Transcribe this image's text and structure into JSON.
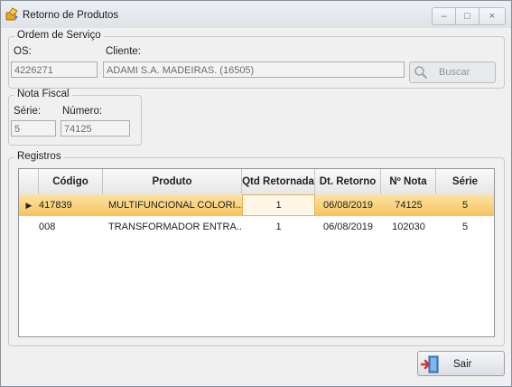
{
  "window": {
    "title": "Retorno de Produtos",
    "minimize_glyph": "–",
    "maximize_glyph": "□",
    "close_glyph": "×"
  },
  "ordem_servico": {
    "legend": "Ordem de Serviço",
    "os_label": "OS:",
    "os_value": "4226271",
    "cliente_label": "Cliente:",
    "cliente_value": "ADAMI S.A. MADEIRAS. (16505)",
    "buscar_label": "Buscar"
  },
  "nota_fiscal": {
    "legend": "Nota Fiscal",
    "serie_label": "Série:",
    "serie_value": "5",
    "numero_label": "Número:",
    "numero_value": "74125"
  },
  "registros": {
    "legend": "Registros",
    "columns": [
      "Código",
      "Produto",
      "Qtd Retornada",
      "Dt. Retorno",
      "Nº Nota",
      "Série"
    ],
    "rows": [
      [
        "417839",
        "MULTIFUNCIONAL COLORI...",
        "1",
        "06/08/2019",
        "74125",
        "5"
      ],
      [
        "008",
        "TRANSFORMADOR ENTRA...",
        "1",
        "06/08/2019",
        "102030",
        "5"
      ]
    ],
    "selected_row_indicator": "▶"
  },
  "footer": {
    "sair_label": "Sair"
  },
  "colors": {
    "selected_row": "#f6c25f",
    "window_bg": "#f0f0f0"
  },
  "icons": [
    "app-icon",
    "search-icon",
    "exit-door-icon"
  ]
}
